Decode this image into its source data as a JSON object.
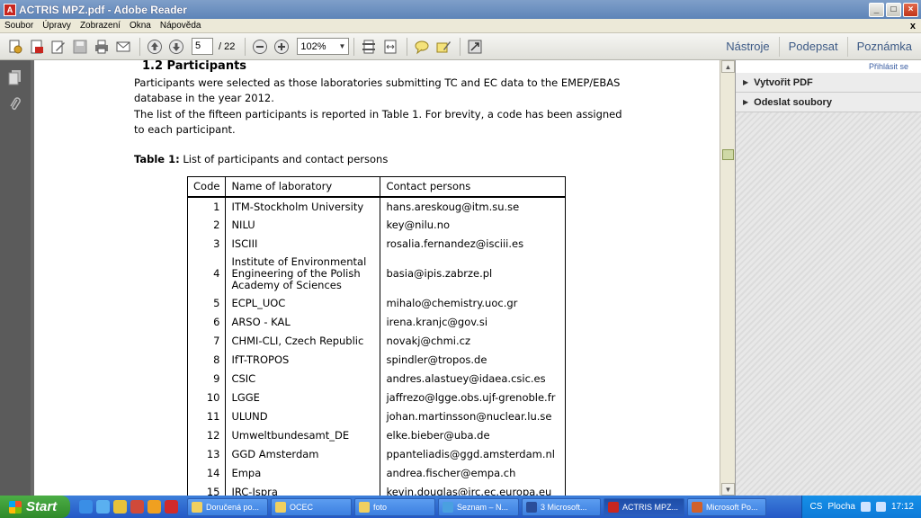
{
  "window": {
    "title": "ACTRIS MPZ.pdf - Adobe Reader",
    "controls": [
      "_",
      "□",
      "×"
    ]
  },
  "menu": {
    "items": [
      "Soubor",
      "Úpravy",
      "Zobrazení",
      "Okna",
      "Nápověda"
    ],
    "close_glyph": "x"
  },
  "toolbar": {
    "page_current": "5",
    "page_total": "/ 22",
    "zoom": "102%",
    "tools_label": "Nástroje",
    "sign_label": "Podepsat",
    "comment_label": "Poznámka"
  },
  "document": {
    "heading": "1.2  Participants",
    "paragraphs": [
      "Participants were selected as those laboratories submitting TC and EC data to the EMEP/EBAS",
      "database in the year 2012.",
      "The list of the fifteen participants is reported in Table 1. For brevity, a code has been assigned",
      "to each participant."
    ],
    "table_caption_bold": "Table 1:",
    "table_caption_text": " List of participants and contact persons",
    "table": {
      "headers": [
        "Code",
        "Name of laboratory",
        "Contact persons"
      ],
      "rows": [
        {
          "code": "1",
          "name": "ITM-Stockholm University",
          "contact": "hans.areskoug@itm.su.se"
        },
        {
          "code": "2",
          "name": "NILU",
          "contact": "key@nilu.no"
        },
        {
          "code": "3",
          "name": "ISCIII",
          "contact": "rosalia.fernandez@isciii.es"
        },
        {
          "code": "4",
          "name": "Institute of Environmental Engineering of the Polish Academy of Sciences",
          "contact": "basia@ipis.zabrze.pl"
        },
        {
          "code": "5",
          "name": "ECPL_UOC",
          "contact": "mihalo@chemistry.uoc.gr"
        },
        {
          "code": "6",
          "name": "ARSO - KAL",
          "contact": "irena.kranjc@gov.si"
        },
        {
          "code": "7",
          "name": "CHMI-CLI, Czech Republic",
          "contact": "novakj@chmi.cz"
        },
        {
          "code": "8",
          "name": "IfT-TROPOS",
          "contact": "spindler@tropos.de"
        },
        {
          "code": "9",
          "name": "CSIC",
          "contact": "andres.alastuey@idaea.csic.es"
        },
        {
          "code": "10",
          "name": "LGGE",
          "contact": "jaffrezo@lgge.obs.ujf-grenoble.fr"
        },
        {
          "code": "11",
          "name": "ULUND",
          "contact": "johan.martinsson@nuclear.lu.se"
        },
        {
          "code": "12",
          "name": "Umweltbundesamt_DE",
          "contact": "elke.bieber@uba.de"
        },
        {
          "code": "13",
          "name": "GGD Amsterdam",
          "contact": "ppanteliadis@ggd.amsterdam.nl"
        },
        {
          "code": "14",
          "name": "Empa",
          "contact": "andrea.fischer@empa.ch"
        },
        {
          "code": "15",
          "name": "JRC-Ispra",
          "contact": "kevin.douglas@jrc.ec.europa.eu"
        }
      ]
    }
  },
  "right_panel": {
    "sign_in": "Přihlásit se",
    "items": [
      "Vytvořit PDF",
      "Odeslat soubory"
    ]
  },
  "taskbar": {
    "start": "Start",
    "tasks": [
      "Doručená po...",
      "OCEC",
      "foto",
      "Seznam – N...",
      "3 Microsoft...",
      "ACTRIS MPZ...",
      "Microsoft Po..."
    ],
    "tray_label": "Plocha",
    "tray_cs": "CS",
    "clock": "17:12"
  },
  "colors": {
    "titlebar": "#5d84b8",
    "link_blue": "#3d5a86",
    "start_green": "#2f8a2a",
    "taskbar_blue": "#2458c6"
  }
}
